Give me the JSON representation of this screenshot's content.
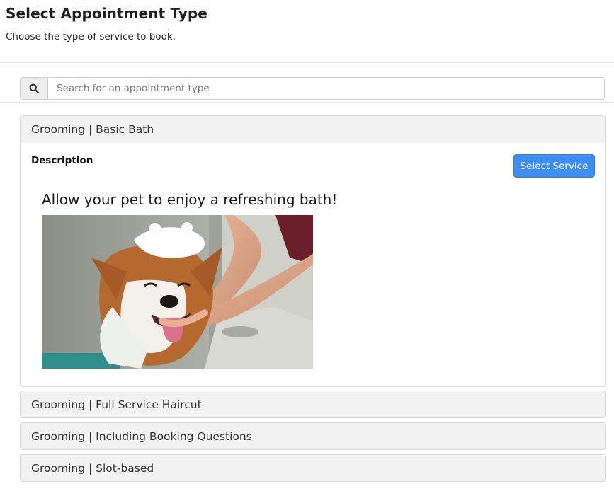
{
  "header": {
    "title": "Select Appointment Type",
    "subtitle": "Choose the type of service to book."
  },
  "search": {
    "icon": "search-icon",
    "placeholder": "Search for an appointment type",
    "value": ""
  },
  "services": [
    {
      "label": "Grooming | Basic Bath",
      "expanded": true,
      "description_label": "Description",
      "select_label": "Select Service",
      "description_heading": "Allow your pet to enjoy a refreshing bath!"
    },
    {
      "label": "Grooming | Full Service Haircut",
      "expanded": false
    },
    {
      "label": "Grooming | Including Booking Questions",
      "expanded": false
    },
    {
      "label": "Grooming | Slot-based",
      "expanded": false
    }
  ],
  "colors": {
    "accent": "#3d8ef0",
    "panel_header_bg": "#f2f2f2",
    "border": "#d9d9d9"
  }
}
